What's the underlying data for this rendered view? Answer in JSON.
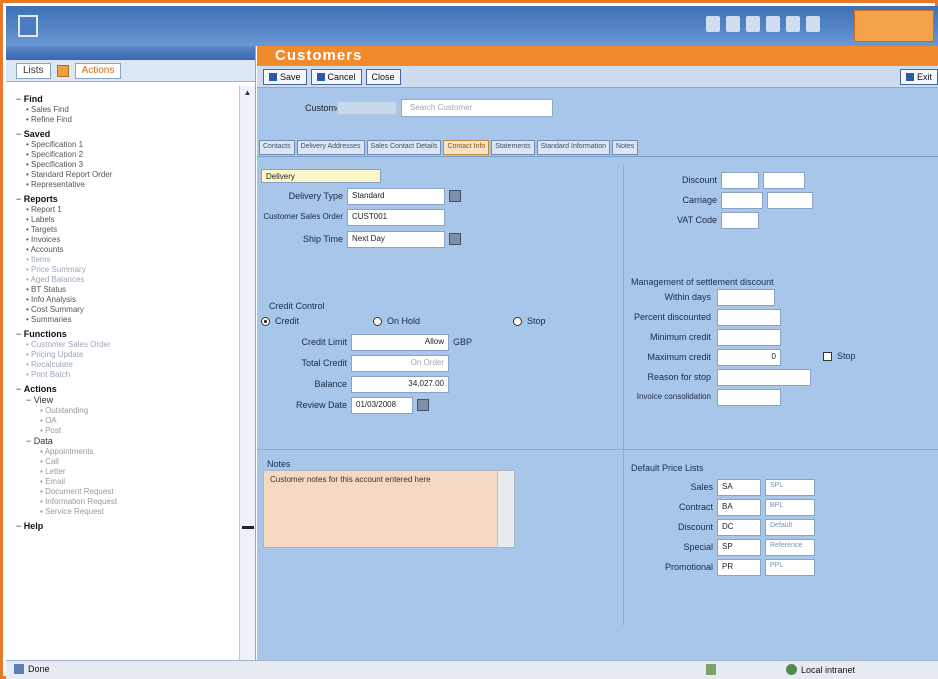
{
  "app": {
    "brand_label": "",
    "page_title": "Customers"
  },
  "left_panel": {
    "tabs": [
      "Lists",
      "Actions"
    ],
    "tree": [
      {
        "group": "Find",
        "items": [
          {
            "t": "Sales Find",
            "m": false
          },
          {
            "t": "Refine Find",
            "m": false
          }
        ]
      },
      {
        "group": "Saved",
        "items": [
          {
            "t": "Specification 1",
            "m": false
          },
          {
            "t": "Specification 2",
            "m": false
          },
          {
            "t": "Specification 3",
            "m": false
          },
          {
            "t": "Standard Report Order",
            "m": false
          },
          {
            "t": "Representative",
            "m": false
          }
        ]
      },
      {
        "group": "Reports",
        "items": [
          {
            "t": "Report 1",
            "m": false
          },
          {
            "t": "Labels",
            "m": false
          },
          {
            "t": "Targets",
            "m": false
          },
          {
            "t": "Invoices",
            "m": false
          },
          {
            "t": "Accounts",
            "m": false
          },
          {
            "t": "Items",
            "m": true
          },
          {
            "t": "Price Summary",
            "m": true
          },
          {
            "t": "Aged Balances",
            "m": true
          },
          {
            "t": "BT Status",
            "m": false
          },
          {
            "t": "Info Analysis",
            "m": false
          },
          {
            "t": "Cost Summary",
            "m": false
          },
          {
            "t": "Summaries",
            "m": false
          }
        ]
      },
      {
        "group": "Functions",
        "items": [
          {
            "t": "Customer Sales Order",
            "m": true
          },
          {
            "t": "Pricing Update",
            "m": true
          },
          {
            "t": "Recalculate",
            "m": true
          },
          {
            "t": "Print Batch",
            "m": true
          }
        ]
      },
      {
        "group": "Actions",
        "subs": [
          {
            "label": "View",
            "items": [
              "Outstanding",
              "OA",
              "Post"
            ]
          },
          {
            "label": "Data",
            "items": [
              "Appointments",
              "Call",
              "Letter",
              "Email",
              "Document Request",
              "Information Request",
              "Service Request"
            ]
          }
        ]
      },
      {
        "group": "Help",
        "items": []
      }
    ]
  },
  "toolbar": {
    "save_label": "Save",
    "cancel_label": "Cancel",
    "close_label": "Close",
    "exit_label": "Exit"
  },
  "customer": {
    "label": "Customer",
    "name_placeholder": "Search Customer"
  },
  "subtabs": [
    "Contacts",
    "Delivery Addresses",
    "Sales Contact Details",
    "Contact Info",
    "Statements",
    "Standard Information",
    "Notes"
  ],
  "form": {
    "delivery_label": "Delivery",
    "delivery_type_label": "Delivery Type",
    "delivery_type_value": "Standard",
    "customer_sales_order_label": "Customer Sales Order",
    "customer_sales_order_value": "CUST001",
    "ship_time_label": "Ship Time",
    "ship_time_value": "Next Day",
    "credit_control_label": "Credit Control",
    "credit_radio": "Credit",
    "hold_radio": "On Hold",
    "stop_radio": "Stop",
    "credit_limit_label": "Credit Limit",
    "credit_limit_unit": "GBP",
    "credit_limit_value": "Allow",
    "credit_used_label": "Total Credit",
    "credit_used_value": "On Order",
    "balance_label": "Balance",
    "balance_value": "34,027.00",
    "review_date_label": "Review Date",
    "review_date_value": "01/03/2008",
    "notes_label": "Notes",
    "notes_text": "Customer notes for this account entered here"
  },
  "right_top": {
    "discount_label": "Discount",
    "carriage_label": "Carriage",
    "vat_label": "VAT Code"
  },
  "settlement": {
    "title": "Management of settlement discount",
    "within_days_label": "Within days",
    "percent_label": "Percent discounted",
    "min_credit_label": "Minimum credit",
    "max_credit_label": "Maximum credit",
    "max_credit_value": "0",
    "stop_label": "Stop",
    "reason_label": "Reason for stop",
    "invoice_label": "Invoice consolidation"
  },
  "default_prices": {
    "title": "Default Price Lists",
    "rows": [
      {
        "label": "Sales",
        "code": "SA",
        "desc": "SPL"
      },
      {
        "label": "Contract",
        "code": "BA",
        "desc": "BPL"
      },
      {
        "label": "Discount",
        "code": "DC",
        "desc": "Default"
      },
      {
        "label": "Special",
        "code": "SP",
        "desc": "Reference"
      },
      {
        "label": "Promotional",
        "code": "PR",
        "desc": "PPL"
      }
    ]
  },
  "status": {
    "left": "Done",
    "zone": "Local intranet"
  }
}
